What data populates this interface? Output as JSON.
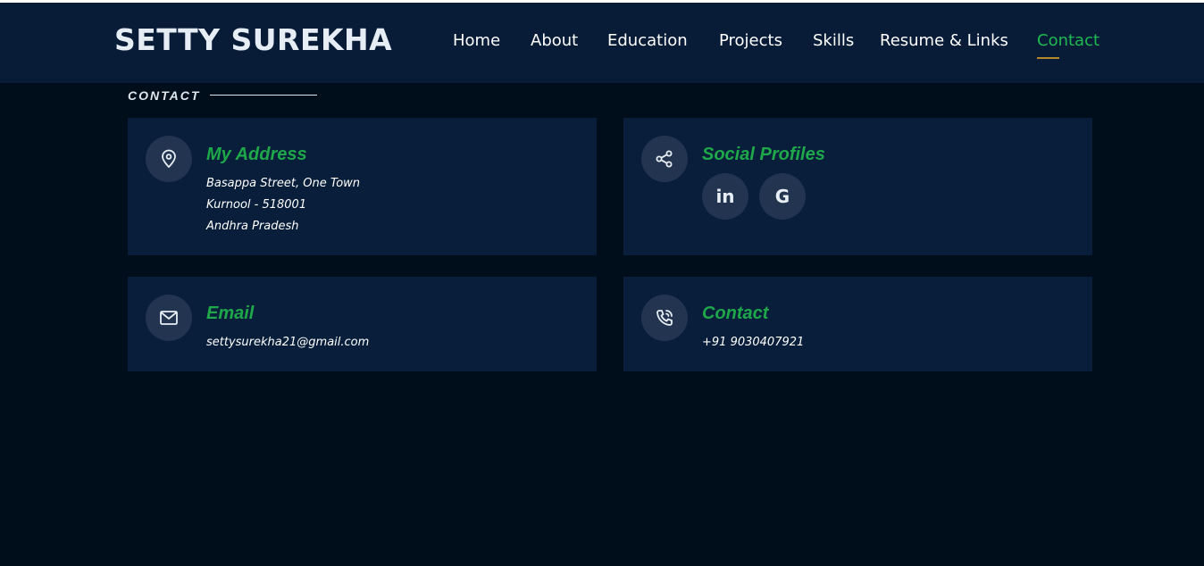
{
  "site": {
    "logo": "SETTY SUREKHA"
  },
  "nav": [
    {
      "label": "Home"
    },
    {
      "label": "About"
    },
    {
      "label": "Education"
    },
    {
      "label": "Projects"
    },
    {
      "label": "Skills"
    },
    {
      "label": "Resume & Links"
    },
    {
      "label": "Contact",
      "active": true
    }
  ],
  "section": {
    "title": "CONTACT"
  },
  "address": {
    "title": "My Address",
    "line1": "Basappa Street, One Town",
    "line2": "Kurnool - 518001",
    "line3": "Andhra Pradesh",
    "icon": "location-pin-icon"
  },
  "social": {
    "title": "Social Profiles",
    "icon": "share-icon",
    "profiles": [
      {
        "icon": "linkedin-icon",
        "glyph": "in"
      },
      {
        "icon": "google-icon",
        "glyph": "G"
      }
    ]
  },
  "email": {
    "title": "Email",
    "value": "settysurekha21@gmail.com",
    "icon": "mail-icon"
  },
  "phone": {
    "title": "Contact",
    "value": "+91 9030407921",
    "icon": "phone-icon"
  },
  "colors": {
    "header_bg": "#081c38",
    "page_bg": "#000d1a",
    "card_bg": "#081e3a",
    "accent_green": "#1fba4f",
    "underline_gold": "#b3882a"
  }
}
